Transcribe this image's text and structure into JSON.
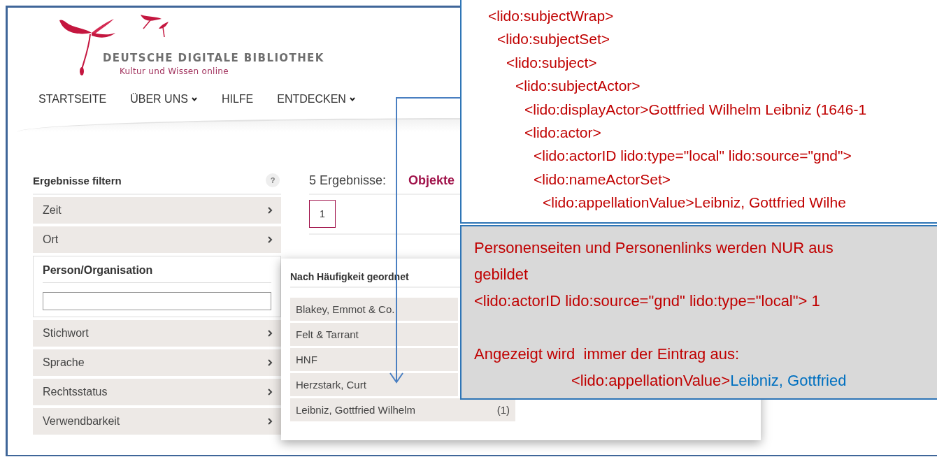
{
  "site": {
    "title": "DEUTSCHE DIGITALE BIBLIOTHEK",
    "tagline": "Kultur und Wissen online"
  },
  "nav": [
    {
      "label": "STARTSEITE",
      "dropdown": false
    },
    {
      "label": "ÜBER UNS",
      "dropdown": true
    },
    {
      "label": "HILFE",
      "dropdown": false
    },
    {
      "label": "ENTDECKEN",
      "dropdown": true
    }
  ],
  "filters": {
    "title": "Ergebnisse filtern",
    "help": "?",
    "items": [
      {
        "label": "Zeit",
        "expanded": false
      },
      {
        "label": "Ort",
        "expanded": false
      },
      {
        "label": "Person/Organisation",
        "expanded": true
      },
      {
        "label": "Stichwort",
        "expanded": false
      },
      {
        "label": "Sprache",
        "expanded": false
      },
      {
        "label": "Rechtsstatus",
        "expanded": false
      },
      {
        "label": "Verwendbarkeit",
        "expanded": false
      }
    ]
  },
  "results": {
    "count": "5 Ergebnisse:",
    "tabs": [
      {
        "label": "Objekte",
        "selected": true
      }
    ],
    "pages": [
      {
        "label": "1",
        "selected": true
      }
    ]
  },
  "person_popup": {
    "heading": "Nach Häufigkeit geordnet",
    "entries": [
      {
        "name": "Blakey, Emmot & Co."
      },
      {
        "name": "Felt & Tarrant"
      },
      {
        "name": "HNF"
      },
      {
        "name": "Herzstark, Curt"
      },
      {
        "name": "Leibniz, Gottfried Wilhelm",
        "count": "(1)"
      }
    ]
  },
  "code_callout": {
    "lines": [
      {
        "text": "<lido:subjectWrap>",
        "children": [
          {
            "text": "<lido:subjectSet>",
            "children": [
              {
                "text": "<lido:subject>",
                "children": [
                  {
                    "text": "<lido:subjectActor>",
                    "children": [
                      {
                        "text": "<lido:displayActor>Gottfried Wilhelm Leibniz (1646-1"
                      },
                      {
                        "text": "<lido:actor>",
                        "children": [
                          {
                            "text": "<lido:actorID lido:type=\"local\" lido:source=\"gnd\">"
                          },
                          {
                            "text": "<lido:nameActorSet>",
                            "children": [
                              {
                                "text": "<lido:appellationValue>Leibniz, Gottfried Wilhe"
                              }
                            ]
                          }
                        ]
                      }
                    ]
                  }
                ]
              }
            ]
          }
        ]
      }
    ]
  },
  "note_callout": {
    "paragraphs": [
      [
        "Personenseiten und Personenlinks werden NUR aus",
        "gebildet",
        "<lido:actorID lido:source=\"gnd\" lido:type=\"local\"> 1"
      ],
      [
        "Angezeigt wird  immer der Eintrag aus:"
      ]
    ],
    "value_line": {
      "tag": "<lido:appellationValue>",
      "value": "Leibniz, Gottfried"
    }
  }
}
